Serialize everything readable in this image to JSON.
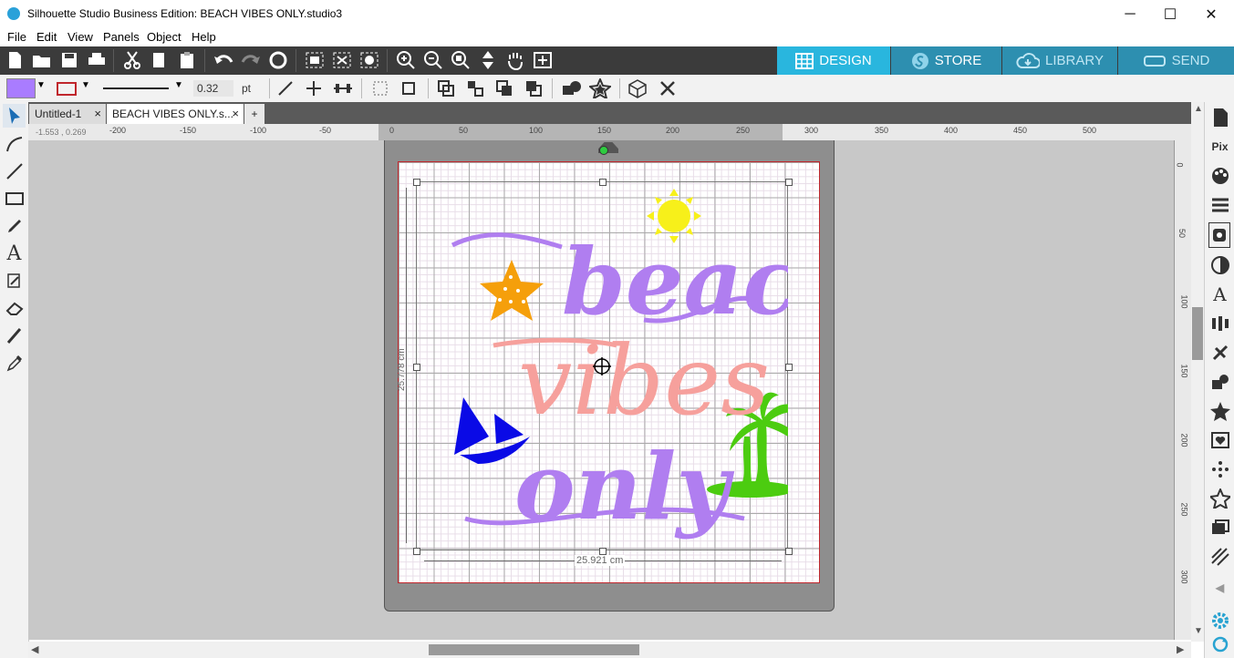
{
  "window": {
    "title": "Silhouette Studio Business Edition: BEACH VIBES ONLY.studio3",
    "minimize": "─",
    "maximize": "☐",
    "close": "✕"
  },
  "menu": [
    "File",
    "Edit",
    "View",
    "Panels",
    "Object",
    "Help"
  ],
  "nav_tabs": {
    "design": "DESIGN",
    "store": "STORE",
    "library": "LIBRARY",
    "send": "SEND"
  },
  "line_options": {
    "fill_color": "#a97cff",
    "line_color": "#c0262c",
    "line_width": "0.32",
    "unit": "pt"
  },
  "doc_tabs": [
    {
      "label": "Untitled-1"
    },
    {
      "label": "BEACH VIBES ONLY.s..."
    }
  ],
  "add_tab": "+",
  "close_glyph": "×",
  "ruler": {
    "coords": "-1.553 , 0.269",
    "h_ticks": [
      "-200",
      "-150",
      "-100",
      "-50",
      "0",
      "50",
      "100",
      "150",
      "200",
      "250",
      "300",
      "350",
      "400",
      "450",
      "500"
    ],
    "v_ticks": [
      "0",
      "50",
      "100",
      "150",
      "200",
      "250",
      "300"
    ]
  },
  "selection": {
    "height_label": "25.778 cm",
    "width_label": "25.921 cm"
  },
  "design_text": {
    "word1": "beach",
    "word2": "vibes",
    "word3": "only"
  },
  "colors": {
    "purple": "#b07ef0",
    "pink": "#f6a09c",
    "orange": "#f59f0b",
    "yellow": "#f7f01a",
    "blue": "#0a0ae6",
    "green": "#4ccc10",
    "accent": "#29b6de"
  },
  "right_panel_labels": {
    "pix": "Pix"
  }
}
